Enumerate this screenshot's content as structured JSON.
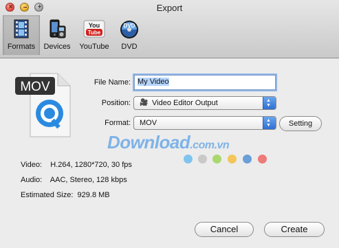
{
  "window": {
    "title": "Export"
  },
  "toolbar": {
    "items": [
      {
        "label": "Formats",
        "icon": "film-icon"
      },
      {
        "label": "Devices",
        "icon": "devices-icon"
      },
      {
        "label": "YouTube",
        "icon": "youtube-icon"
      },
      {
        "label": "DVD",
        "icon": "dvd-icon"
      }
    ],
    "youtube_logo": {
      "you": "You",
      "tube": "Tube"
    },
    "dvd_logo": "DVD"
  },
  "file_icon": {
    "badge": "MOV"
  },
  "form": {
    "file_name_label": "File Name:",
    "file_name_value": "My Video",
    "position_label": "Position:",
    "position_value": "Video Editor Output",
    "format_label": "Format:",
    "format_value": "MOV",
    "setting_button": "Setting"
  },
  "info": {
    "video": "Video:    H.264, 1280*720, 30 fps",
    "audio": "Audio:    AAC, Stereo, 128 kbps",
    "size": "Estimated Size:  929.8 MB"
  },
  "watermark": {
    "text": "Download",
    "suffix": ".com.vn"
  },
  "footer": {
    "cancel": "Cancel",
    "create": "Create"
  },
  "colors": {
    "accent": "#2f6fd1",
    "focus_ring": "#8fb4e6"
  }
}
